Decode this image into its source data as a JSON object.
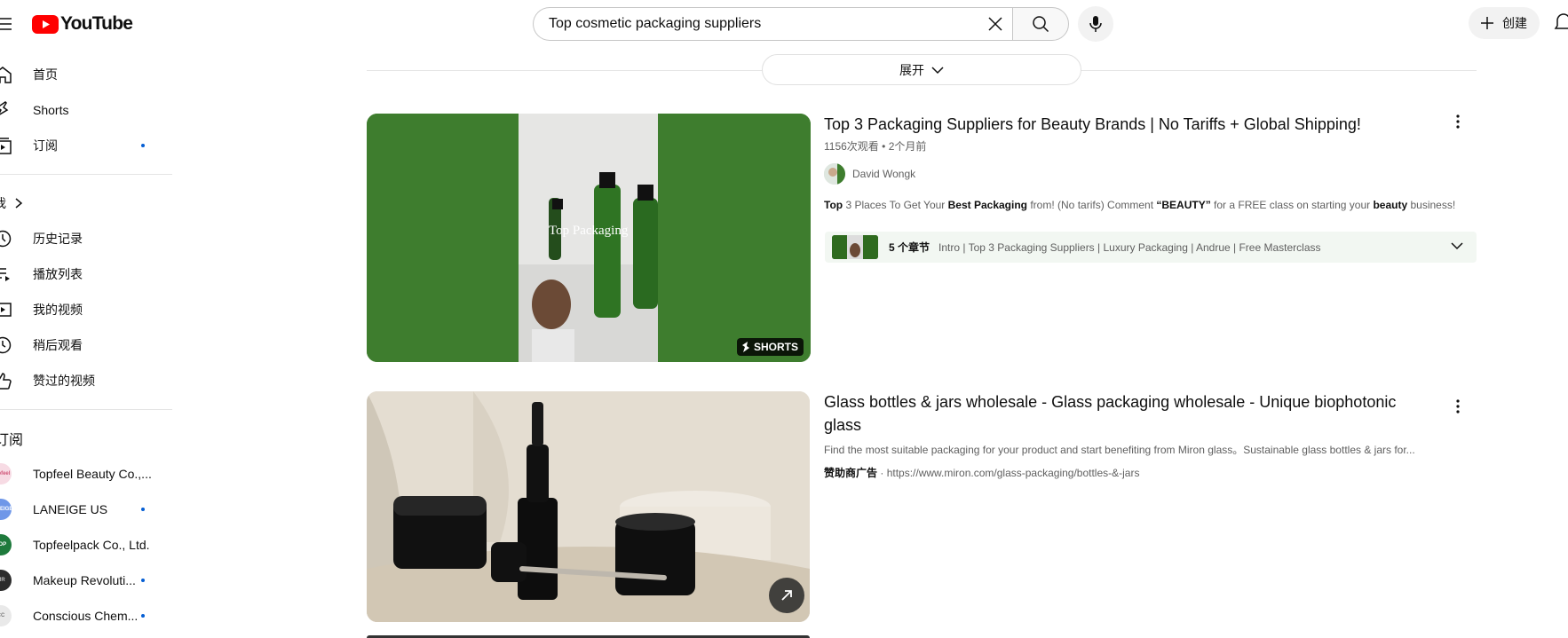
{
  "header": {
    "logo_text": "YouTube",
    "search_value": "Top cosmetic packaging suppliers",
    "create_label": "创建"
  },
  "sidebar": {
    "main_items": [
      {
        "label": "首页",
        "icon": "home-icon"
      },
      {
        "label": "Shorts",
        "icon": "shorts-icon"
      },
      {
        "label": "订阅",
        "icon": "subscriptions-icon",
        "dot": true
      }
    ],
    "you_heading": "我",
    "you_items": [
      {
        "label": "历史记录",
        "icon": "history-icon"
      },
      {
        "label": "播放列表",
        "icon": "playlists-icon"
      },
      {
        "label": "我的视频",
        "icon": "your-videos-icon"
      },
      {
        "label": "稍后观看",
        "icon": "watch-later-icon"
      },
      {
        "label": "赞过的视频",
        "icon": "liked-icon"
      }
    ],
    "subs_heading": "订阅",
    "subscriptions": [
      {
        "label": "Topfeel Beauty Co.,...",
        "color": "#f4c6d4",
        "dot": false
      },
      {
        "label": "LANEIGE US",
        "color": "#6f97e8",
        "dot": true
      },
      {
        "label": "Topfeelpack Co., Ltd.",
        "color": "#1e7a3c",
        "dot": false
      },
      {
        "label": "Makeup Revoluti...",
        "color": "#2b2b2b",
        "dot": true
      },
      {
        "label": "Conscious Chem...",
        "color": "#e9e9e9",
        "dot": true
      }
    ]
  },
  "results": {
    "expand_label": "展开",
    "video1": {
      "title": "Top 3 Packaging Suppliers for Beauty Brands | No Tariffs + Global Shipping!",
      "views": "1156次观看",
      "age": "2个月前",
      "channel": "David Wongk",
      "desc_parts": [
        "Top",
        " 3 Places To Get Your ",
        "Best Packaging",
        " from! (No tarifs) Comment ",
        "“BEAUTY”",
        " for a FREE class on starting your ",
        "beauty",
        " business!"
      ],
      "thumb_caption": "Top Packaging",
      "shorts_badge": "SHORTS",
      "chapters_count": "5 个章节",
      "chapters_text": "Intro | Top 3 Packaging Suppliers | Luxury Packaging | Andrue | Free Masterclass"
    },
    "ad": {
      "title": "Glass bottles & jars wholesale - Glass packaging wholesale - Unique biophotonic glass",
      "desc": "Find the most suitable packaging for your product and start benefiting from Miron glass。Sustainable glass bottles & jars for...",
      "sponsor_label": "赞助商广告",
      "url": "https://www.miron.com/glass-packaging/bottles-&-jars"
    }
  },
  "colors": {
    "brand_red": "#ff0000",
    "thumb_green": "#3e7d2e",
    "notification_dot": "#065fd4"
  }
}
